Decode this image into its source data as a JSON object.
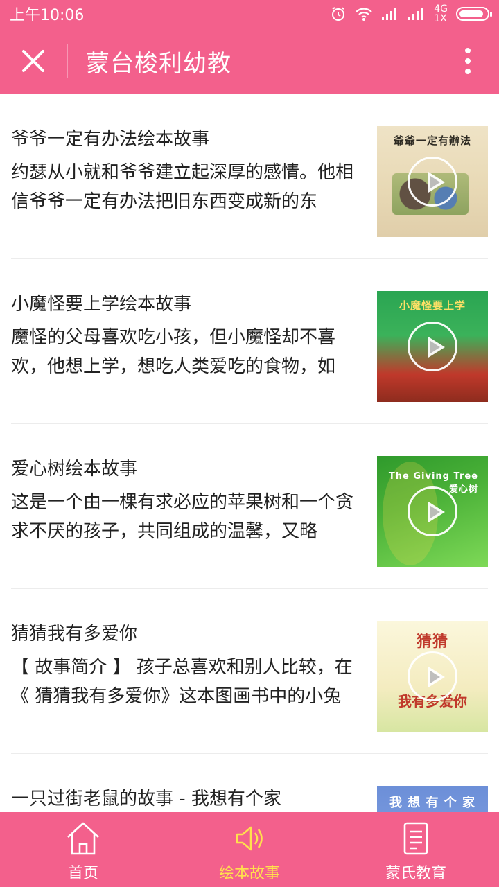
{
  "status_bar": {
    "time": "上午10:06",
    "network": "4G",
    "network_sub": "1X",
    "battery_level": 0.9
  },
  "app_bar": {
    "title": "蒙台梭利幼教",
    "close_icon": "close-icon",
    "more_icon": "more-vertical-icon"
  },
  "articles": [
    {
      "title": "爷爷一定有办法绘本故事",
      "desc": "约瑟从小就和爷爷建立起深厚的感情。他相信爷爷一定有办法把旧东西变成新的东",
      "cover_text": "爺爺一定有辦法"
    },
    {
      "title": "小魔怪要上学绘本故事",
      "desc": "魔怪的父母喜欢吃小孩，但小魔怪却不喜欢，他想上学，想吃人类爱吃的食物，如",
      "cover_text": "小魔怪要上学"
    },
    {
      "title": "爱心树绘本故事",
      "desc": "这是一个由一棵有求必应的苹果树和一个贪求不厌的孩子，共同组成的温馨，又略",
      "cover_text": "The Giving Tree 爱心树"
    },
    {
      "title": "猜猜我有多爱你",
      "desc": "【 故事简介 】 孩子总喜欢和别人比较，在《 猜猜我有多爱你》这本图画书中的小兔",
      "cover_text": "猜猜",
      "cover_sub": "我有多爱你"
    },
    {
      "title": "一只过街老鼠的故事 - 我想有个家",
      "desc": "",
      "cover_text": "我 想 有 个 家"
    }
  ],
  "tabs": [
    {
      "label": "首页",
      "icon": "home-icon",
      "active": false
    },
    {
      "label": "绘本故事",
      "icon": "speaker-icon",
      "active": true
    },
    {
      "label": "蒙氏教育",
      "icon": "document-icon",
      "active": false
    }
  ],
  "colors": {
    "primary": "#f3608c",
    "active_tab": "#ffe14d"
  }
}
